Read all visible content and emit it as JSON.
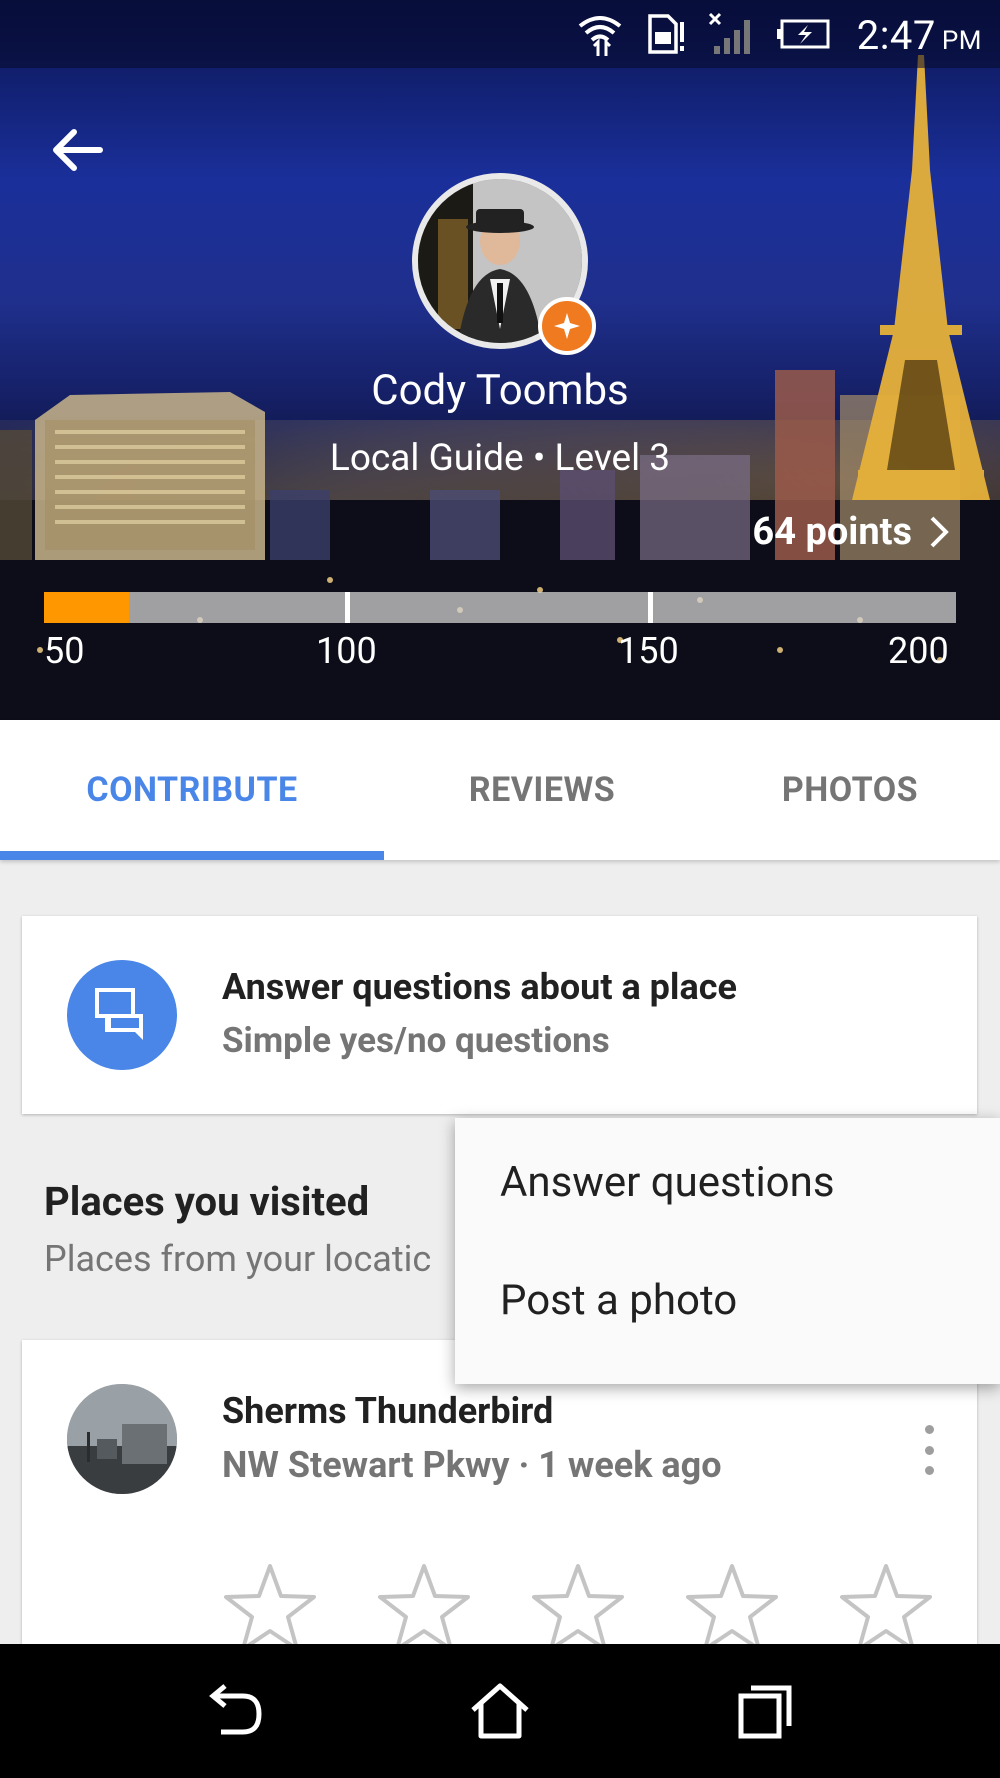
{
  "status": {
    "time": "2:47",
    "ampm": "PM"
  },
  "profile": {
    "name": "Cody Toombs",
    "level": "Local Guide • Level 3",
    "points_label": "64 points",
    "progress": {
      "min": 50,
      "max": 200,
      "value": 64,
      "ticks": [
        "50",
        "100",
        "150",
        "200"
      ]
    }
  },
  "tabs": [
    {
      "label": "CONTRIBUTE",
      "active": true
    },
    {
      "label": "REVIEWS",
      "active": false
    },
    {
      "label": "PHOTOS",
      "active": false
    }
  ],
  "question_card": {
    "title": "Answer questions about a place",
    "subtitle": "Simple yes/no questions"
  },
  "visited": {
    "title": "Places you visited",
    "subtitle": "Places from your locatic"
  },
  "place": {
    "name": "Sherms Thunderbird",
    "meta": "NW Stewart Pkwy · 1 week ago",
    "rating": 0,
    "max_rating": 5
  },
  "menu": {
    "items": [
      "Answer questions",
      "Post a photo"
    ]
  },
  "colors": {
    "accent": "#4a86e8",
    "progress": "#ff9800",
    "badge": "#f07a20"
  }
}
